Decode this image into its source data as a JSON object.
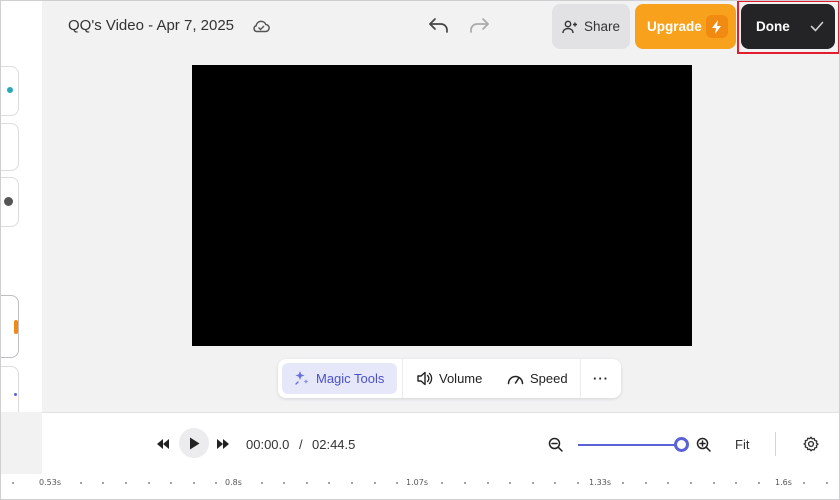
{
  "header": {
    "title": "QQ's Video - Apr 7, 2025",
    "share_label": "Share",
    "upgrade_label": "Upgrade",
    "done_label": "Done"
  },
  "video_toolbar": {
    "magic_tools_label": "Magic Tools",
    "volume_label": "Volume",
    "speed_label": "Speed",
    "more_label": "···"
  },
  "playback": {
    "current_time": "00:00.0",
    "separator": "/",
    "total_time": "02:44.5",
    "fit_label": "Fit",
    "zoom_level": 1.0
  },
  "ruler": {
    "labels": [
      "0.53s",
      "0.8s",
      "1.07s",
      "1.33s",
      "1.6s"
    ]
  },
  "colors": {
    "accent": "#5b62d6",
    "upgrade": "#f8a11c",
    "done": "#242426",
    "highlight": "#e11d2e"
  }
}
